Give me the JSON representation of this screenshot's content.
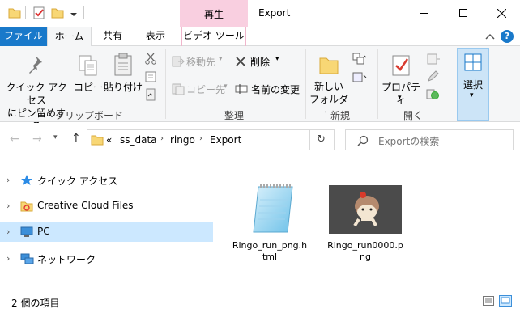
{
  "title": {
    "context_tab": "再生",
    "window_title": "Export"
  },
  "ribbon_tabs": {
    "file": "ファイル",
    "home": "ホーム",
    "share": "共有",
    "view": "表示",
    "video_tools": "ビデオ ツール"
  },
  "ribbon": {
    "clipboard": {
      "pin_label": "クイック アクセス\nにピン留めする",
      "copy": "コピー",
      "paste": "貼り付け",
      "group": "クリップボード"
    },
    "organize": {
      "move_to": "移動先",
      "copy_to": "コピー先",
      "delete": "削除",
      "rename": "名前の変更",
      "group": "整理"
    },
    "new": {
      "new_folder": "新しい\nフォルダー",
      "group": "新規"
    },
    "open": {
      "properties": "プロパティ",
      "group": "開く"
    },
    "select": {
      "select": "選択"
    }
  },
  "address": {
    "overflow": "«",
    "crumbs": [
      "ss_data",
      "ringo",
      "Export"
    ],
    "search_placeholder": "Exportの検索"
  },
  "nav": {
    "items": [
      {
        "label": "クイック アクセス",
        "icon": "star-icon"
      },
      {
        "label": "Creative Cloud Files",
        "icon": "creative-cloud-folder-icon"
      },
      {
        "label": "PC",
        "icon": "pc-icon"
      },
      {
        "label": "ネットワーク",
        "icon": "network-icon"
      }
    ]
  },
  "files": [
    {
      "name_line1": "Ringo_run_png.h",
      "name_line2": "tml",
      "icon": "notepad-icon"
    },
    {
      "name_line1": "Ringo_run0000.p",
      "name_line2": "ng",
      "icon": "image-thumbnail-icon"
    }
  ],
  "status": {
    "item_count": "2 個の項目"
  },
  "colors": {
    "accent": "#1979ca",
    "file_tab": "#1979ca",
    "context_tab": "#f9cfe0",
    "selected_nav": "#cce8ff"
  }
}
